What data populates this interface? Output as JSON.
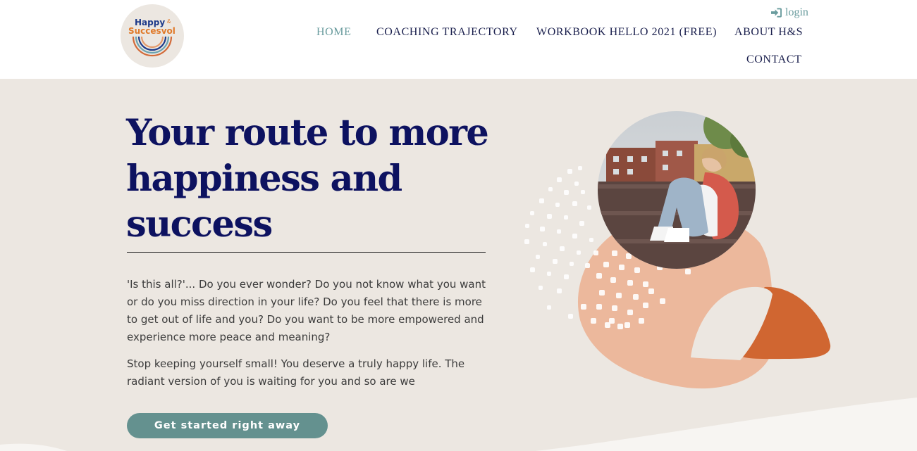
{
  "header": {
    "logo": {
      "line1": "Happy",
      "amp": "&",
      "line2": "Succesvol"
    },
    "login_label": "login",
    "nav": [
      "HOME",
      "COACHING TRAJECTORY",
      "WORKBOOK HELLO 2021 (FREE)",
      "ABOUT H&S",
      "CONTACT"
    ],
    "active_nav": "HOME"
  },
  "hero": {
    "title_lines": [
      "Your route to more",
      "happiness and",
      "success"
    ],
    "paragraph1": "'Is this all?'... Do you ever wonder? Do you not know what you want or do you miss direction in your life? Do you feel that there is more to get out of life and you? Do you want to be more empowered and experience more peace and meaning?",
    "paragraph2": "Stop keeping yourself small! You deserve a truly happy life. The radiant version of you is waiting for you and so are we",
    "cta_label": "Get started right away"
  },
  "colors": {
    "navy": "#0d1260",
    "teal": "#6a9c9e",
    "button": "#64918f",
    "background": "#ece7e1",
    "peach": "#ecb89c",
    "rust": "#d06631"
  },
  "icons": [
    "sign-in-icon"
  ]
}
